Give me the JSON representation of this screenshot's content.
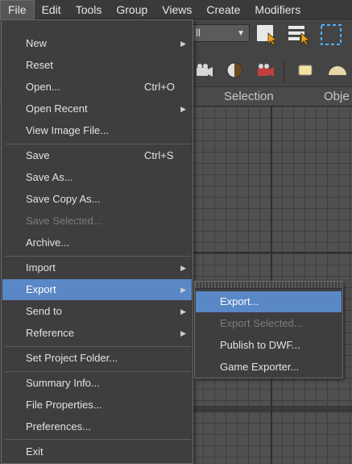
{
  "menubar": {
    "items": [
      "File",
      "Edit",
      "Tools",
      "Group",
      "Views",
      "Create",
      "Modifiers"
    ]
  },
  "toolbar": {
    "selection_filter_value": "ll",
    "icons": [
      "select-object-icon",
      "select-by-name-icon",
      "rectangular-selection-icon"
    ]
  },
  "toolbar2": {
    "icons": [
      "camera-icon",
      "render-setup-icon",
      "render-frame-icon",
      "material-slot-icon",
      "dome-light-icon"
    ]
  },
  "ribbon": {
    "tabs": [
      "Selection",
      "Obje"
    ]
  },
  "file_menu": {
    "items": [
      {
        "label": "New",
        "shortcut": "",
        "submenu": true,
        "disabled": false
      },
      {
        "label": "Reset",
        "shortcut": "",
        "submenu": false,
        "disabled": false
      },
      {
        "label": "Open...",
        "shortcut": "Ctrl+O",
        "submenu": false,
        "disabled": false
      },
      {
        "label": "Open Recent",
        "shortcut": "",
        "submenu": true,
        "disabled": false
      },
      {
        "label": "View Image File...",
        "shortcut": "",
        "submenu": false,
        "disabled": false
      },
      {
        "label": "Save",
        "shortcut": "Ctrl+S",
        "submenu": false,
        "disabled": false
      },
      {
        "label": "Save As...",
        "shortcut": "",
        "submenu": false,
        "disabled": false
      },
      {
        "label": "Save Copy As...",
        "shortcut": "",
        "submenu": false,
        "disabled": false
      },
      {
        "label": "Save Selected...",
        "shortcut": "",
        "submenu": false,
        "disabled": true
      },
      {
        "label": "Archive...",
        "shortcut": "",
        "submenu": false,
        "disabled": false
      },
      {
        "label": "Import",
        "shortcut": "",
        "submenu": true,
        "disabled": false
      },
      {
        "label": "Export",
        "shortcut": "",
        "submenu": true,
        "disabled": false,
        "highlighted": true
      },
      {
        "label": "Send to",
        "shortcut": "",
        "submenu": true,
        "disabled": false
      },
      {
        "label": "Reference",
        "shortcut": "",
        "submenu": true,
        "disabled": false
      },
      {
        "label": "Set Project Folder...",
        "shortcut": "",
        "submenu": false,
        "disabled": false
      },
      {
        "label": "Summary Info...",
        "shortcut": "",
        "submenu": false,
        "disabled": false
      },
      {
        "label": "File Properties...",
        "shortcut": "",
        "submenu": false,
        "disabled": false
      },
      {
        "label": "Preferences...",
        "shortcut": "",
        "submenu": false,
        "disabled": false
      },
      {
        "label": "Exit",
        "shortcut": "",
        "submenu": false,
        "disabled": false
      }
    ]
  },
  "export_submenu": {
    "items": [
      {
        "label": "Export...",
        "disabled": false,
        "highlighted": true
      },
      {
        "label": "Export Selected...",
        "disabled": true
      },
      {
        "label": "Publish to DWF...",
        "disabled": false
      },
      {
        "label": "Game Exporter...",
        "disabled": false
      }
    ]
  },
  "colors": {
    "highlight": "#5a87c5",
    "menu_bg": "#3e3e3e",
    "disabled_text": "#7c7c7c"
  }
}
